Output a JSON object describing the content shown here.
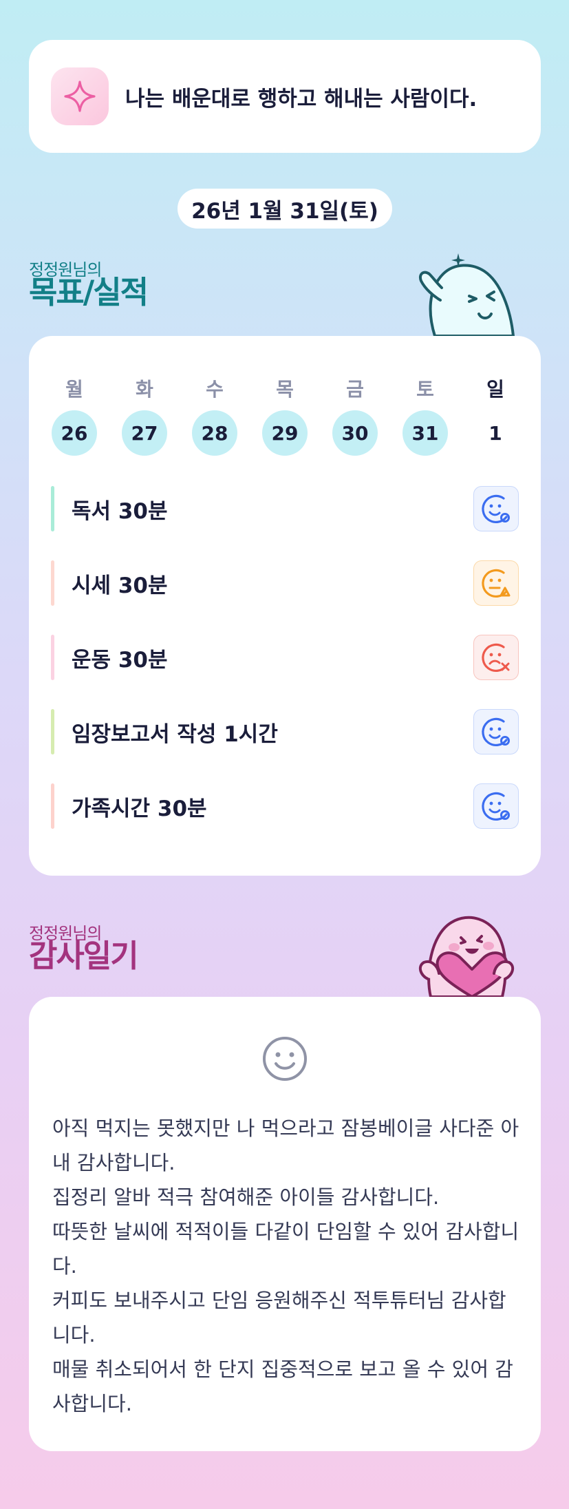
{
  "motto": {
    "icon": "sparkle-icon",
    "text": "나는 배운대로 행하고 해내는 사람이다."
  },
  "date_label": "26년 1월 31일(토)",
  "goals_section": {
    "subtitle": "정정원님의",
    "title": "목표/실적",
    "title_color": "#127f87"
  },
  "calendar": {
    "days": [
      "월",
      "화",
      "수",
      "목",
      "금",
      "토",
      "일"
    ],
    "dates": [
      "26",
      "27",
      "28",
      "29",
      "30",
      "31",
      "1"
    ]
  },
  "goals": [
    {
      "label": "독서 30분",
      "bar_color": "#a9ecd8",
      "status": "done",
      "status_icon": "smile-circle-icon",
      "status_color": "#3b6df0"
    },
    {
      "label": "시세 30분",
      "bar_color": "#fdd8d0",
      "status": "partial",
      "status_icon": "smile-triangle-icon",
      "status_color": "#f39a1e"
    },
    {
      "label": "운동 30분",
      "bar_color": "#fbd2e2",
      "status": "failed",
      "status_icon": "smile-x-icon",
      "status_color": "#ee5a4c"
    },
    {
      "label": "임장보고서 작성 1시간",
      "bar_color": "#d6ecb0",
      "status": "done",
      "status_icon": "smile-circle-icon",
      "status_color": "#3b6df0"
    },
    {
      "label": "가족시간 30분",
      "bar_color": "#fdd2cc",
      "status": "done",
      "status_icon": "smile-circle-icon",
      "status_color": "#3b6df0"
    }
  ],
  "gratitude_section": {
    "subtitle": "정정원님의",
    "title": "감사일기",
    "title_color": "#a3337e"
  },
  "gratitude": {
    "icon": "smiley-icon",
    "lines": [
      "아직 먹지는 못했지만 나 먹으라고 잠봉베이글 사다준 아내 감사합니다.",
      "집정리 알바 적극 참여해준 아이들 감사합니다.",
      "따뜻한 날씨에 적적이들 다같이 단임할 수 있어 감사합니다.",
      "커피도 보내주시고 단임 응원해주신 적투튜터님 감사합니다.",
      "매물 취소되어서 한 단지 집중적으로 보고 올 수 있어 감사합니다."
    ]
  }
}
